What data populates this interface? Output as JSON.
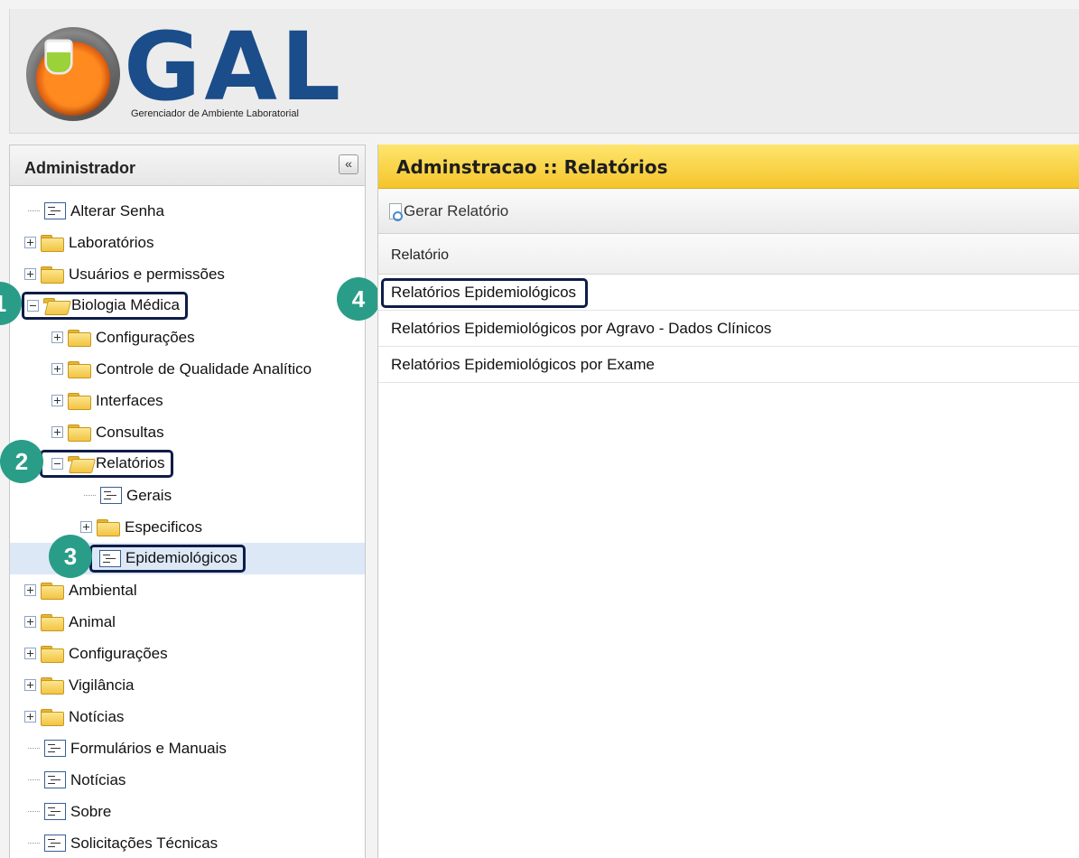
{
  "header": {
    "logo_text": "GAL",
    "logo_subtitle": "Gerenciador de Ambiente Laboratorial"
  },
  "sidebar": {
    "title": "Administrador",
    "collapse_glyph": "«",
    "items": [
      {
        "label": "Alterar Senha",
        "icon": "page-icon"
      },
      {
        "label": "Laboratórios",
        "icon": "folder-icon"
      },
      {
        "label": "Usuários e permissões",
        "icon": "folder-icon"
      },
      {
        "label": "Biologia Médica",
        "icon": "folder-open-icon"
      },
      {
        "label": "Configurações",
        "icon": "folder-icon"
      },
      {
        "label": "Controle de Qualidade Analítico",
        "icon": "folder-icon"
      },
      {
        "label": "Interfaces",
        "icon": "folder-icon"
      },
      {
        "label": "Consultas",
        "icon": "folder-icon"
      },
      {
        "label": "Relatórios",
        "icon": "folder-open-icon"
      },
      {
        "label": "Gerais",
        "icon": "page-icon"
      },
      {
        "label": "Especificos",
        "icon": "folder-icon"
      },
      {
        "label": "Epidemiológicos",
        "icon": "page-icon"
      },
      {
        "label": "Ambiental",
        "icon": "folder-icon"
      },
      {
        "label": "Animal",
        "icon": "folder-icon"
      },
      {
        "label": "Configurações",
        "icon": "folder-icon"
      },
      {
        "label": "Vigilância",
        "icon": "folder-icon"
      },
      {
        "label": "Notícias",
        "icon": "folder-icon"
      },
      {
        "label": "Formulários e Manuais",
        "icon": "page-icon"
      },
      {
        "label": "Notícias",
        "icon": "page-icon"
      },
      {
        "label": "Sobre",
        "icon": "page-icon"
      },
      {
        "label": "Solicitações Técnicas",
        "icon": "page-icon"
      }
    ]
  },
  "badges": [
    "1",
    "2",
    "3",
    "4"
  ],
  "main": {
    "title": "Adminstracao :: Relatórios",
    "toolbar": {
      "gerar_label": "Gerar Relatório"
    },
    "grid": {
      "column_header": "Relatório",
      "rows": [
        "Relatórios Epidemiológicos",
        "Relatórios Epidemiológicos por Agravo - Dados Clínicos",
        "Relatórios Epidemiológicos por Exame"
      ]
    }
  }
}
